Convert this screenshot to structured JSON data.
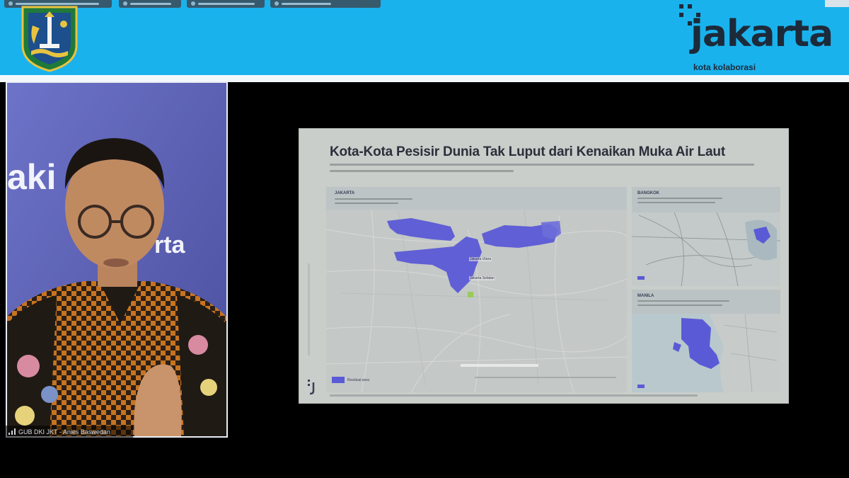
{
  "header": {
    "brand_name": "jakarta",
    "brand_tagline": "kota kolaborasi",
    "brand_color": "#1ab2ec",
    "crest_icon": "jakarta-crest-icon"
  },
  "participant": {
    "name": "GUB DKI JKT - Anies Baswedan",
    "background_text_1": "aki",
    "background_text_2": "rta",
    "signal_icon": "signal-bars-icon"
  },
  "slide": {
    "title": "Kota-Kota Pesisir Dunia Tak Luput dari Kenaikan Muka Air Laut",
    "main_map": {
      "label": "JAKARTA",
      "legend": "Residual area",
      "places": [
        "Jakarta Utara",
        "Jakarta Selatan"
      ],
      "flood_color": "#5b5ad6"
    },
    "inset_1": {
      "label": "BANGKOK"
    },
    "inset_2": {
      "label": "MANILA"
    }
  }
}
